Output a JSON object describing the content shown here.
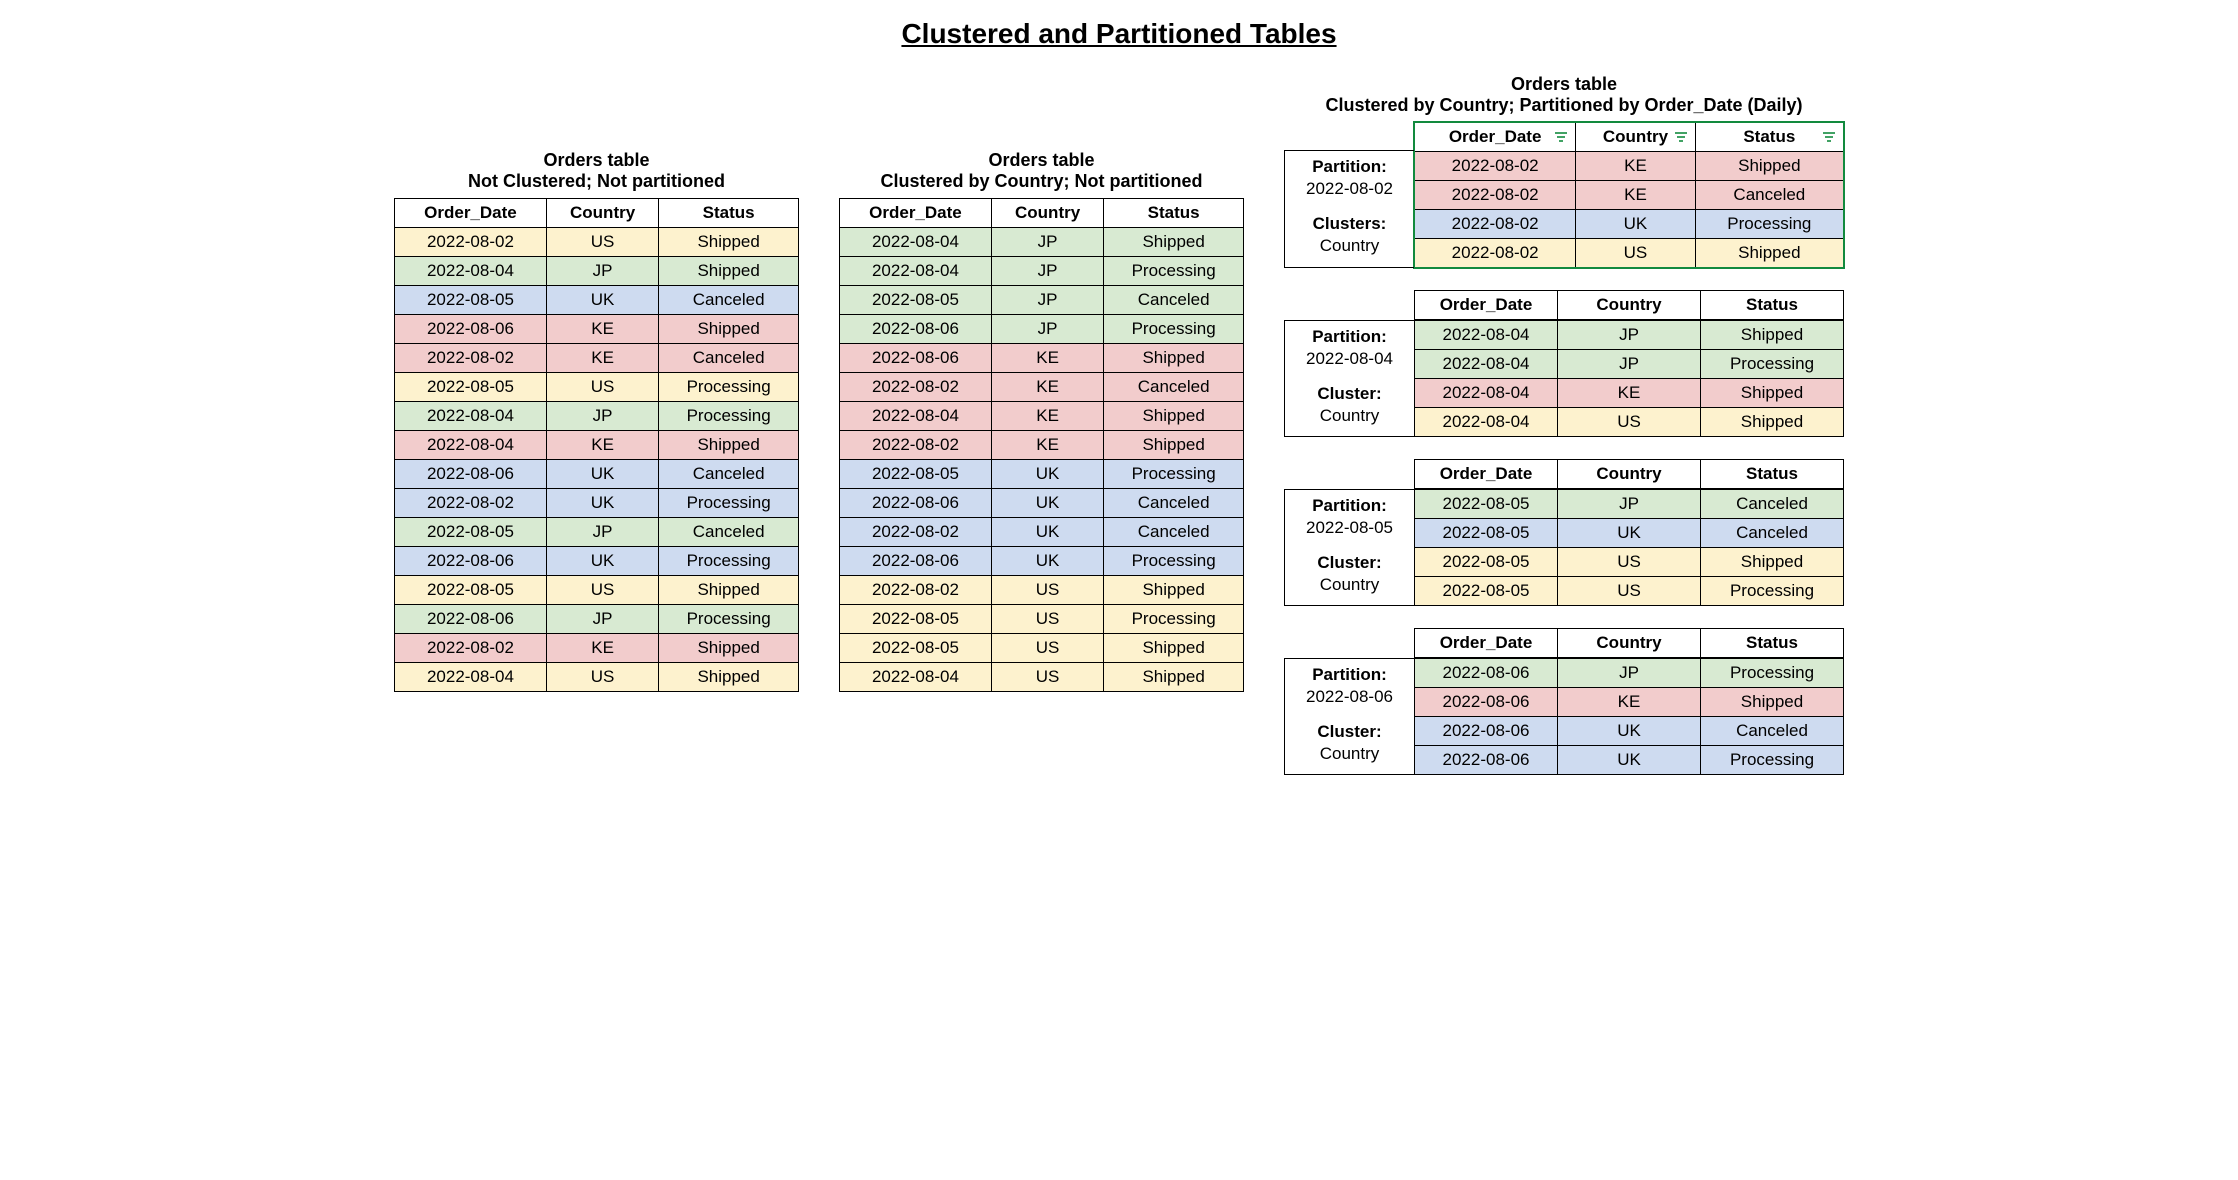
{
  "title": "Clustered and Partitioned Tables",
  "headers": [
    "Order_Date",
    "Country",
    "Status"
  ],
  "tbl_label": "Orders table",
  "sub_not": "Not Clustered; Not partitioned",
  "sub_cl": "Clustered by Country; Not partitioned",
  "sub_both": "Clustered by Country; Partitioned by Order_Date (Daily)",
  "color_map": {
    "US": "c-yellow",
    "JP": "c-green",
    "UK": "c-blue",
    "KE": "c-red"
  },
  "table1": [
    [
      "2022-08-02",
      "US",
      "Shipped"
    ],
    [
      "2022-08-04",
      "JP",
      "Shipped"
    ],
    [
      "2022-08-05",
      "UK",
      "Canceled"
    ],
    [
      "2022-08-06",
      "KE",
      "Shipped"
    ],
    [
      "2022-08-02",
      "KE",
      "Canceled"
    ],
    [
      "2022-08-05",
      "US",
      "Processing"
    ],
    [
      "2022-08-04",
      "JP",
      "Processing"
    ],
    [
      "2022-08-04",
      "KE",
      "Shipped"
    ],
    [
      "2022-08-06",
      "UK",
      "Canceled"
    ],
    [
      "2022-08-02",
      "UK",
      "Processing"
    ],
    [
      "2022-08-05",
      "JP",
      "Canceled"
    ],
    [
      "2022-08-06",
      "UK",
      "Processing"
    ],
    [
      "2022-08-05",
      "US",
      "Shipped"
    ],
    [
      "2022-08-06",
      "JP",
      "Processing"
    ],
    [
      "2022-08-02",
      "KE",
      "Shipped"
    ],
    [
      "2022-08-04",
      "US",
      "Shipped"
    ]
  ],
  "table2": [
    [
      "2022-08-04",
      "JP",
      "Shipped"
    ],
    [
      "2022-08-04",
      "JP",
      "Processing"
    ],
    [
      "2022-08-05",
      "JP",
      "Canceled"
    ],
    [
      "2022-08-06",
      "JP",
      "Processing"
    ],
    [
      "2022-08-06",
      "KE",
      "Shipped"
    ],
    [
      "2022-08-02",
      "KE",
      "Canceled"
    ],
    [
      "2022-08-04",
      "KE",
      "Shipped"
    ],
    [
      "2022-08-02",
      "KE",
      "Shipped"
    ],
    [
      "2022-08-05",
      "UK",
      "Processing"
    ],
    [
      "2022-08-06",
      "UK",
      "Canceled"
    ],
    [
      "2022-08-02",
      "UK",
      "Canceled"
    ],
    [
      "2022-08-06",
      "UK",
      "Processing"
    ],
    [
      "2022-08-02",
      "US",
      "Shipped"
    ],
    [
      "2022-08-05",
      "US",
      "Processing"
    ],
    [
      "2022-08-05",
      "US",
      "Shipped"
    ],
    [
      "2022-08-04",
      "US",
      "Shipped"
    ]
  ],
  "lbl_partition": "Partition:",
  "lbl_clusters": "Clusters:",
  "lbl_cluster": "Cluster:",
  "lbl_country": "Country",
  "partitions": [
    {
      "date": "2022-08-02",
      "cluster_label": "Clusters:",
      "rows": [
        [
          "2022-08-02",
          "KE",
          "Shipped"
        ],
        [
          "2022-08-02",
          "KE",
          "Canceled"
        ],
        [
          "2022-08-02",
          "UK",
          "Processing"
        ],
        [
          "2022-08-02",
          "US",
          "Shipped"
        ]
      ]
    },
    {
      "date": "2022-08-04",
      "cluster_label": "Cluster:",
      "rows": [
        [
          "2022-08-04",
          "JP",
          "Shipped"
        ],
        [
          "2022-08-04",
          "JP",
          "Processing"
        ],
        [
          "2022-08-04",
          "KE",
          "Shipped"
        ],
        [
          "2022-08-04",
          "US",
          "Shipped"
        ]
      ]
    },
    {
      "date": "2022-08-05",
      "cluster_label": "Cluster:",
      "rows": [
        [
          "2022-08-05",
          "JP",
          "Canceled"
        ],
        [
          "2022-08-05",
          "UK",
          "Canceled"
        ],
        [
          "2022-08-05",
          "US",
          "Shipped"
        ],
        [
          "2022-08-05",
          "US",
          "Processing"
        ]
      ]
    },
    {
      "date": "2022-08-06",
      "cluster_label": "Cluster:",
      "rows": [
        [
          "2022-08-06",
          "JP",
          "Processing"
        ],
        [
          "2022-08-06",
          "KE",
          "Shipped"
        ],
        [
          "2022-08-06",
          "UK",
          "Canceled"
        ],
        [
          "2022-08-06",
          "UK",
          "Processing"
        ]
      ]
    }
  ]
}
